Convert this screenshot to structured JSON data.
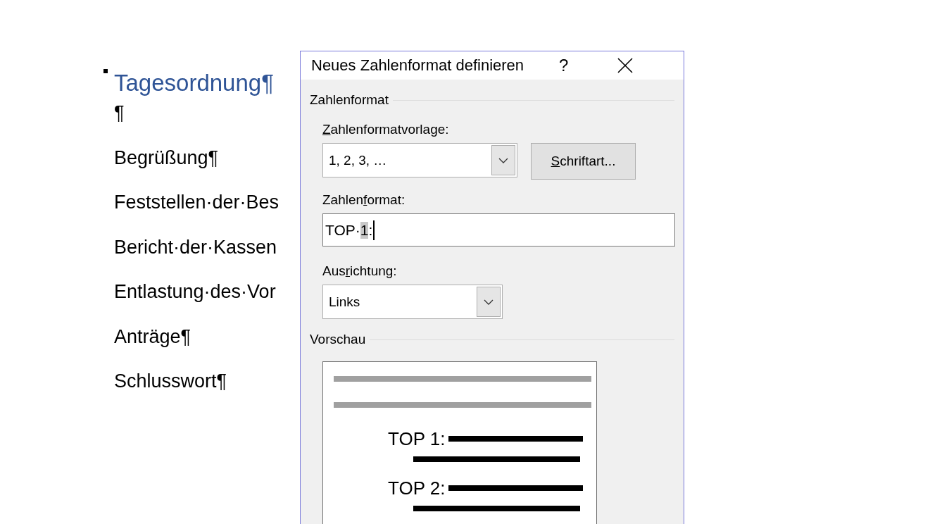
{
  "document": {
    "heading": "Tagesordnung¶",
    "paragraphs": [
      "¶",
      "Begrüßung¶",
      "Feststellen·der·Bes",
      "Bericht·der·Kassen",
      "Entlastung·des·Vor",
      "Anträge¶",
      "Schlusswort¶"
    ]
  },
  "dialog": {
    "title": "Neues Zahlenformat definieren",
    "help": "?",
    "number_format_group": "Zahlenformat",
    "template_label": {
      "key": "Z",
      "after": "ahlenformatvorlage:"
    },
    "template_value": "1, 2, 3, …",
    "font_button": {
      "key": "S",
      "after": "chriftart..."
    },
    "format_label": {
      "before": "Zahlen",
      "key": "f",
      "after": "ormat:"
    },
    "format_value": {
      "before": "TOP·",
      "selected": "1",
      "after": ":"
    },
    "alignment_label": {
      "before": "Aus",
      "key": "r",
      "after": "ichtung:"
    },
    "alignment_value": "Links",
    "preview_group": "Vorschau",
    "preview_items": [
      "TOP 1:",
      "TOP 2:"
    ]
  }
}
